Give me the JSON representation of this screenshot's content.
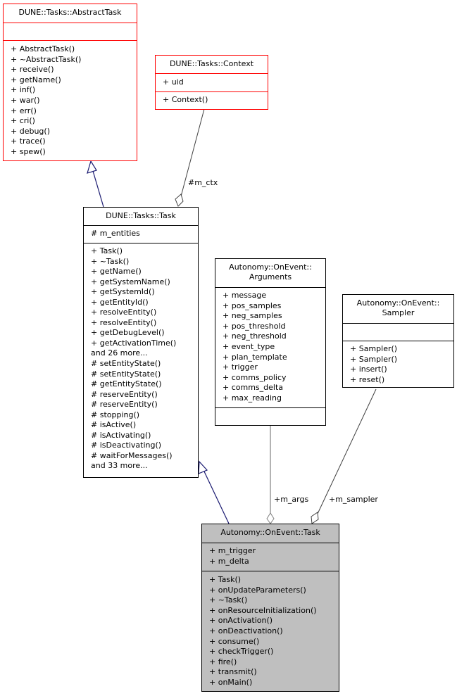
{
  "diagram": {
    "type": "UML class collaboration diagram",
    "colors": {
      "external_border": "#ff0000",
      "normal_border": "#000000",
      "focus_fill": "#bfbfbf",
      "inheritance_edge": "#191970",
      "association_edge": "#404040"
    },
    "classes": {
      "abstract_task": {
        "title": "DUNE::Tasks::AbstractTask",
        "attributes": [],
        "methods": [
          "+ AbstractTask()",
          "+ ~AbstractTask()",
          "+ receive()",
          "+ getName()",
          "+ inf()",
          "+ war()",
          "+ err()",
          "+ cri()",
          "+ debug()",
          "+ trace()",
          "+ spew()"
        ]
      },
      "context": {
        "title": "DUNE::Tasks::Context",
        "attributes": [
          "+ uid"
        ],
        "methods": [
          "+ Context()"
        ]
      },
      "dune_task": {
        "title": "DUNE::Tasks::Task",
        "attributes": [
          "# m_entities"
        ],
        "methods": [
          "+ Task()",
          "+ ~Task()",
          "+ getName()",
          "+ getSystemName()",
          "+ getSystemId()",
          "+ getEntityId()",
          "+ resolveEntity()",
          "+ resolveEntity()",
          "+ getDebugLevel()",
          "+ getActivationTime()",
          "and 26 more...",
          "# setEntityState()",
          "# setEntityState()",
          "# getEntityState()",
          "# reserveEntity()",
          "# reserveEntity()",
          "# stopping()",
          "# isActive()",
          "# isActivating()",
          "# isDeactivating()",
          "# waitForMessages()",
          "and 33 more..."
        ]
      },
      "arguments": {
        "title_lines": [
          "Autonomy::OnEvent::",
          "Arguments"
        ],
        "attributes": [
          "+ message",
          "+ pos_samples",
          "+ neg_samples",
          "+ pos_threshold",
          "+ neg_threshold",
          "+ event_type",
          "+ plan_template",
          "+ trigger",
          "+ comms_policy",
          "+ comms_delta",
          "+ max_reading"
        ],
        "methods": []
      },
      "sampler": {
        "title_lines": [
          "Autonomy::OnEvent::",
          "Sampler"
        ],
        "attributes": [],
        "methods": [
          "+ Sampler()",
          "+ Sampler()",
          "+ insert()",
          "+ reset()"
        ]
      },
      "onevent_task": {
        "title": "Autonomy::OnEvent::Task",
        "attributes": [
          "+ m_trigger",
          "+ m_delta"
        ],
        "methods": [
          "+ Task()",
          "+ onUpdateParameters()",
          "+ ~Task()",
          "+ onResourceInitialization()",
          "+ onActivation()",
          "+ onDeactivation()",
          "+ consume()",
          "+ checkTrigger()",
          "+ fire()",
          "+ transmit()",
          "+ onMain()"
        ]
      }
    },
    "edges": {
      "ctx_label": "#m_ctx",
      "args_label": "+m_args",
      "sampler_label": "+m_sampler"
    }
  }
}
